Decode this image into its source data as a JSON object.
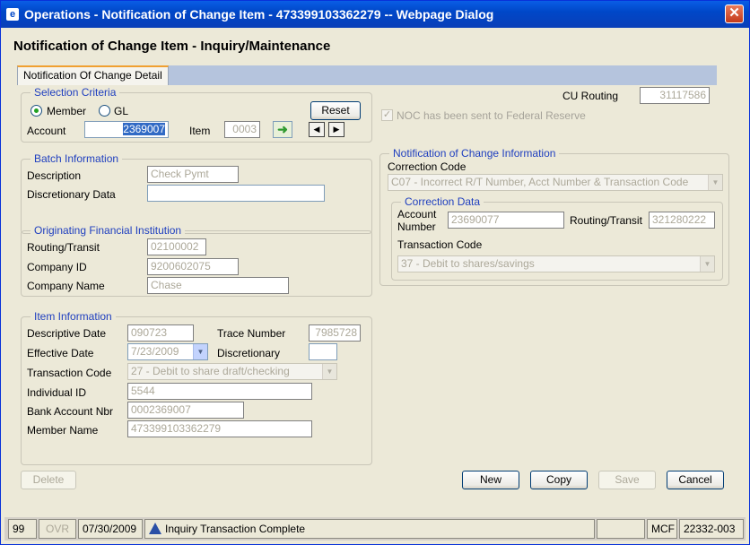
{
  "window": {
    "title": "Operations - Notification of Change Item - 473399103362279 -- Webpage Dialog",
    "app_icon": "e",
    "close_glyph": "✕"
  },
  "page_title": "Notification of Change Item - Inquiry/Maintenance",
  "tabs": [
    {
      "label": "Notification Of Change Detail",
      "active": true
    }
  ],
  "selection": {
    "legend": "Selection Criteria",
    "member_label": "Member",
    "gl_label": "GL",
    "selected": "Member",
    "reset_label": "Reset",
    "account_label": "Account",
    "account_value": "2369007",
    "item_label": "Item",
    "item_value": "0003"
  },
  "cu_routing": {
    "label": "CU Routing",
    "value": "31117586"
  },
  "noc_sent": {
    "label": "NOC has been sent to Federal Reserve",
    "checked": true
  },
  "batch": {
    "legend": "Batch Information",
    "description_label": "Description",
    "description_value": "Check Pymt",
    "discretionary_label": "Discretionary Data",
    "discretionary_value": ""
  },
  "ofi": {
    "legend": "Originating Financial Institution",
    "routing_label": "Routing/Transit",
    "routing_value": "02100002",
    "company_id_label": "Company ID",
    "company_id_value": "9200602075",
    "company_name_label": "Company Name",
    "company_name_value": "Chase"
  },
  "item_info": {
    "legend": "Item Information",
    "desc_date_label": "Descriptive Date",
    "desc_date_value": "090723",
    "trace_label": "Trace Number",
    "trace_value": "7985728",
    "effective_label": "Effective Date",
    "effective_value": "7/23/2009",
    "discretionary_label": "Discretionary",
    "discretionary_value": "",
    "tran_code_label": "Transaction Code",
    "tran_code_value": "27 - Debit to share draft/checking",
    "individual_label": "Individual ID",
    "individual_value": "5544",
    "bank_acct_label": "Bank Account Nbr",
    "bank_acct_value": "0002369007",
    "member_name_label": "Member Name",
    "member_name_value": "473399103362279"
  },
  "noc_info": {
    "legend": "Notification of Change Information",
    "correction_code_label": "Correction Code",
    "correction_code_value": "C07 - Incorrect R/T Number, Acct Number & Transaction Code",
    "correction_data": {
      "legend": "Correction Data",
      "account_label_1": "Account",
      "account_label_2": "Number",
      "account_value": "23690077",
      "routing_label": "Routing/Transit",
      "routing_value": "321280222",
      "tran_code_label": "Transaction Code",
      "tran_code_value": "37 - Debit to shares/savings"
    }
  },
  "buttons": {
    "delete": "Delete",
    "new": "New",
    "copy": "Copy",
    "save": "Save",
    "cancel": "Cancel"
  },
  "statusbar": {
    "code": "99",
    "ovr": "OVR",
    "date": "07/30/2009",
    "message": "Inquiry Transaction Complete",
    "blank": "",
    "mcf": "MCF",
    "id": "22332-003"
  },
  "colors": {
    "title_blue": "#0047c8",
    "legend_blue": "#1f3fbf",
    "tab_accent": "#f0a030"
  }
}
